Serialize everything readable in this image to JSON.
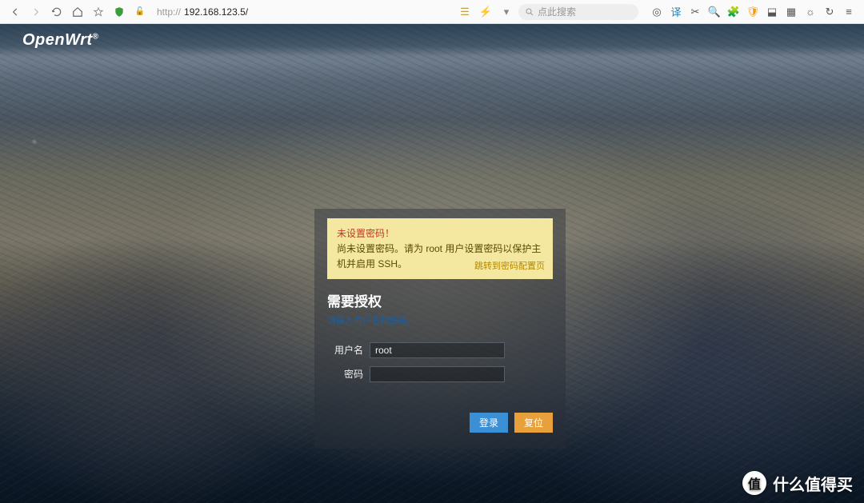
{
  "browser": {
    "url_prefix": "http://",
    "url_host": "192.168.123.5/",
    "search_placeholder": "点此搜索",
    "shield_icon": "shield",
    "lock_label": "🔒"
  },
  "header": {
    "brand": "OpenWrt",
    "brand_sup": "®"
  },
  "alert": {
    "title": "未设置密码！",
    "body": "尚未设置密码。请为 root 用户设置密码以保护主机并启用 SSH。",
    "link": "跳转到密码配置页"
  },
  "auth": {
    "title": "需要授权",
    "subtitle": "请输入用户名和密码。",
    "username_label": "用户名",
    "username_value": "root",
    "password_label": "密码",
    "password_value": "",
    "login_button": "登录",
    "reset_button": "复位"
  },
  "watermark": {
    "badge": "值",
    "text": "什么值得买"
  }
}
